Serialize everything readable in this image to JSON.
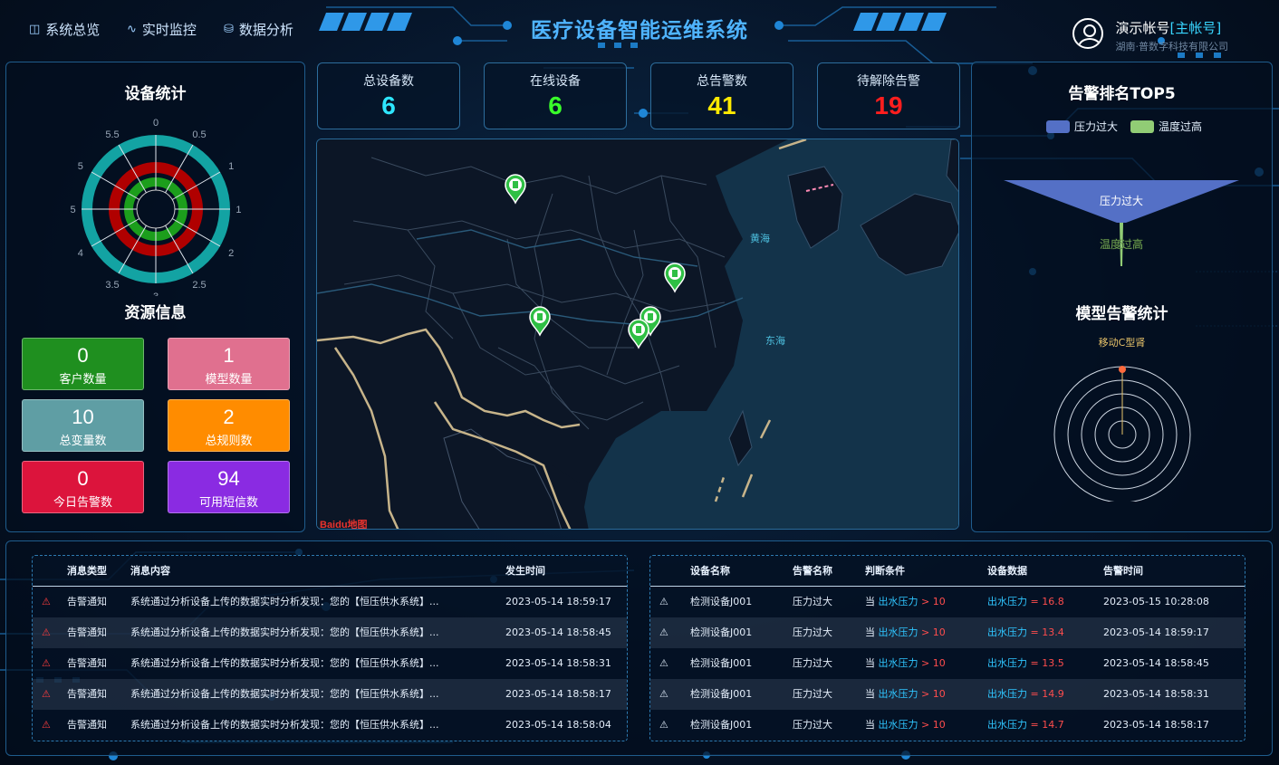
{
  "header": {
    "title": "医疗设备智能运维系统",
    "nav": [
      {
        "label": "系统总览",
        "icon": "dashboard-icon"
      },
      {
        "label": "实时监控",
        "icon": "pulse-icon"
      },
      {
        "label": "数据分析",
        "icon": "database-icon"
      }
    ],
    "user": {
      "name": "演示帐号",
      "role": "[主帐号]",
      "org": "湖南·普数字科技有限公司"
    }
  },
  "stats": [
    {
      "label": "总设备数",
      "value": "6",
      "color": "#2ee6ff"
    },
    {
      "label": "在线设备",
      "value": "6",
      "color": "#39ff2a"
    },
    {
      "label": "总告警数",
      "value": "41",
      "color": "#ffea00"
    },
    {
      "label": "待解除告警",
      "value": "19",
      "color": "#ff1e1e"
    }
  ],
  "device_stats": {
    "title": "设备统计",
    "axis_labels": [
      "0",
      "0.5",
      "1",
      "1.5",
      "2",
      "2.5",
      "3",
      "3.5",
      "4",
      "4.5",
      "5",
      "5.5"
    ],
    "rings": [
      {
        "color": "#13a3a3"
      },
      {
        "color": "#b00000"
      },
      {
        "color": "#1c9e1c"
      }
    ]
  },
  "resources": {
    "title": "资源信息",
    "tiles": [
      {
        "value": "0",
        "label": "客户数量",
        "color": "#1f8f1f"
      },
      {
        "value": "1",
        "label": "模型数量",
        "color": "#e0708f"
      },
      {
        "value": "10",
        "label": "总变量数",
        "color": "#5f9ea4"
      },
      {
        "value": "2",
        "label": "总规则数",
        "color": "#ff8c00"
      },
      {
        "value": "0",
        "label": "今日告警数",
        "color": "#dc143c"
      },
      {
        "value": "94",
        "label": "可用短信数",
        "color": "#8a2be2"
      }
    ]
  },
  "map": {
    "sea_labels": [
      "黄海",
      "东海"
    ],
    "attribution": "Baidu地图",
    "marker_icon": "device-marker-icon"
  },
  "alarm_top5": {
    "title": "告警排名TOP5",
    "legend": [
      {
        "name": "压力过大",
        "color": "#5470c6"
      },
      {
        "name": "温度过高",
        "color": "#91cc75"
      }
    ],
    "chart_data": {
      "type": "funnel",
      "categories": [
        "压力过大",
        "温度过高"
      ]
    }
  },
  "model_alarm": {
    "title": "模型告警统计",
    "chart_label": "移动C型肾"
  },
  "messages": {
    "headers": [
      "消息类型",
      "消息内容",
      "发生时间"
    ],
    "rows": [
      {
        "type": "告警通知",
        "content": "系统通过分析设备上传的数据实时分析发现：您的【恒压供水系统】...",
        "time": "2023-05-14 18:59:17"
      },
      {
        "type": "告警通知",
        "content": "系统通过分析设备上传的数据实时分析发现：您的【恒压供水系统】...",
        "time": "2023-05-14 18:58:45"
      },
      {
        "type": "告警通知",
        "content": "系统通过分析设备上传的数据实时分析发现：您的【恒压供水系统】...",
        "time": "2023-05-14 18:58:31"
      },
      {
        "type": "告警通知",
        "content": "系统通过分析设备上传的数据实时分析发现：您的【恒压供水系统】...",
        "time": "2023-05-14 18:58:17"
      },
      {
        "type": "告警通知",
        "content": "系统通过分析设备上传的数据实时分析发现：您的【恒压供水系统】...",
        "time": "2023-05-14 18:58:04"
      }
    ]
  },
  "alarms": {
    "headers": [
      "设备名称",
      "告警名称",
      "判断条件",
      "设备数据",
      "告警时间"
    ],
    "rows": [
      {
        "device": "检测设备J001",
        "name": "压力过大",
        "cond_prefix": "当",
        "cond_var": "出水压力",
        "cond_op": "> 10",
        "data_var": "出水压力",
        "data_eq": "=",
        "data_val": "16.8",
        "time": "2023-05-15 10:28:08"
      },
      {
        "device": "检测设备J001",
        "name": "压力过大",
        "cond_prefix": "当",
        "cond_var": "出水压力",
        "cond_op": "> 10",
        "data_var": "出水压力",
        "data_eq": "=",
        "data_val": "13.4",
        "time": "2023-05-14 18:59:17"
      },
      {
        "device": "检测设备J001",
        "name": "压力过大",
        "cond_prefix": "当",
        "cond_var": "出水压力",
        "cond_op": "> 10",
        "data_var": "出水压力",
        "data_eq": "=",
        "data_val": "13.5",
        "time": "2023-05-14 18:58:45"
      },
      {
        "device": "检测设备J001",
        "name": "压力过大",
        "cond_prefix": "当",
        "cond_var": "出水压力",
        "cond_op": "> 10",
        "data_var": "出水压力",
        "data_eq": "=",
        "data_val": "14.9",
        "time": "2023-05-14 18:58:31"
      },
      {
        "device": "检测设备J001",
        "name": "压力过大",
        "cond_prefix": "当",
        "cond_var": "出水压力",
        "cond_op": "> 10",
        "data_var": "出水压力",
        "data_eq": "=",
        "data_val": "14.7",
        "time": "2023-05-14 18:58:17"
      }
    ]
  }
}
